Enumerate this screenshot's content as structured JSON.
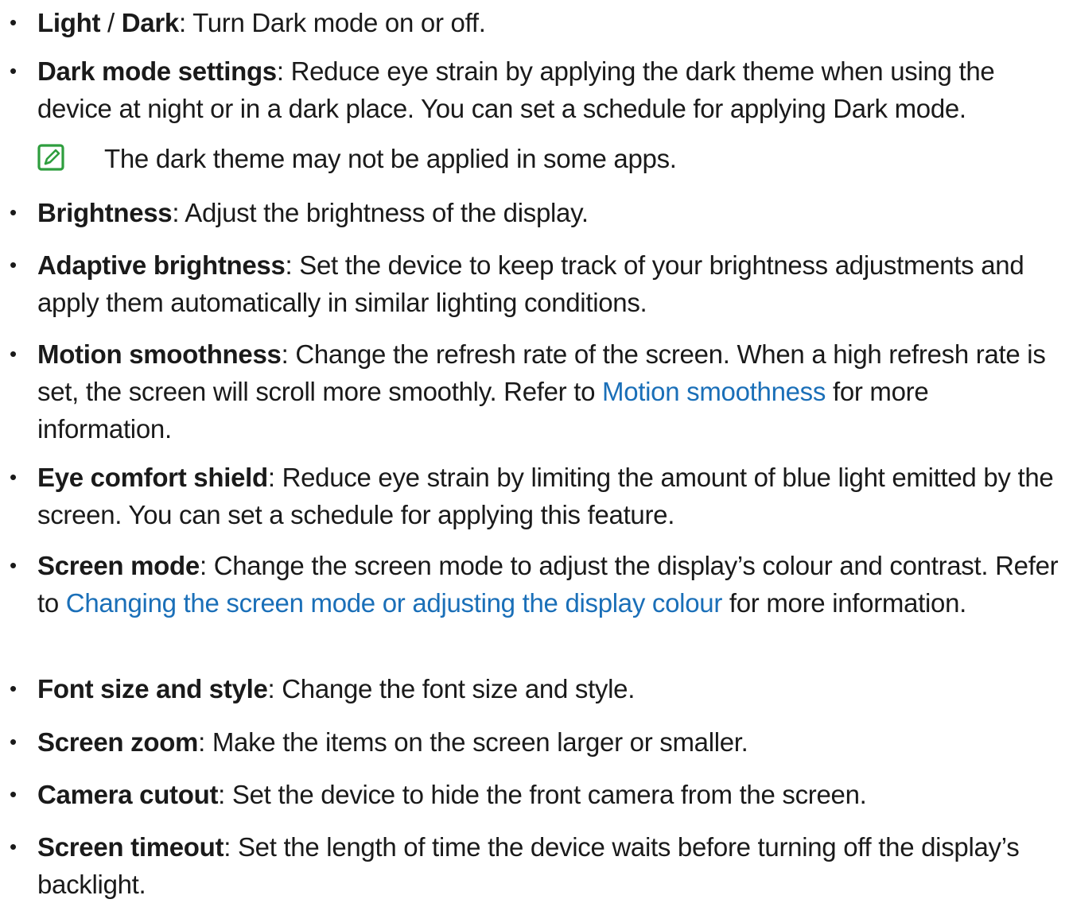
{
  "items": [
    {
      "term": "Light",
      "sep": " / ",
      "term2": "Dark",
      "desc": ": Turn Dark mode on or off."
    },
    {
      "term": "Dark mode settings",
      "desc": ": Reduce eye strain by applying the dark theme when using the device at night or in a dark place. You can set a schedule for applying Dark mode."
    },
    {
      "term": "Brightness",
      "desc": ": Adjust the brightness of the display."
    },
    {
      "term": "Adaptive brightness",
      "desc": ": Set the device to keep track of your brightness adjustments and apply them automatically in similar lighting conditions."
    },
    {
      "term": "Motion smoothness",
      "desc": ": Change the refresh rate of the screen. When a high refresh rate is set, the screen will scroll more smoothly. Refer to ",
      "link": "Motion smoothness",
      "tail": " for more information."
    },
    {
      "term": "Eye comfort shield",
      "desc": ": Reduce eye strain by limiting the amount of blue light emitted by the screen. You can set a schedule for applying this feature."
    },
    {
      "term": "Screen mode",
      "desc": ": Change the screen mode to adjust the display’s colour and contrast. Refer to ",
      "link": "Changing the screen mode or adjusting the display colour",
      "tail": " for more information."
    },
    {
      "term": "Font size and style",
      "desc": ": Change the font size and style."
    },
    {
      "term": "Screen zoom",
      "desc": ": Make the items on the screen larger or smaller."
    },
    {
      "term": "Camera cutout",
      "desc": ": Set the device to hide the front camera from the screen."
    },
    {
      "term": "Screen timeout",
      "desc": ": Set the length of time the device waits before turning off the display’s backlight."
    }
  ],
  "note": {
    "icon": "note-pencil-icon",
    "text": "The dark theme may not be applied in some apps."
  },
  "bullet_char": "•",
  "colors": {
    "text": "#1a1a1a",
    "link": "#1a6fb8",
    "note_icon": "#2e9e3e"
  }
}
